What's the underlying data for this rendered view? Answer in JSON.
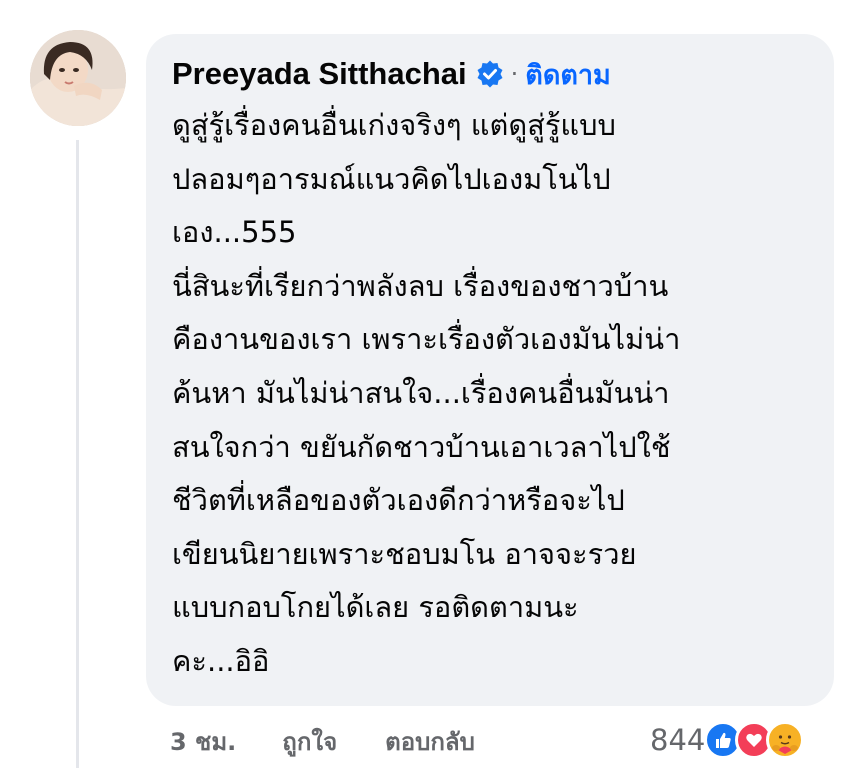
{
  "comment": {
    "author": "Preeyada Sitthachai",
    "verified": true,
    "follow_label": "ติดตาม",
    "separator": "·",
    "lines": [
      "ดูสู่รู้เรื่องคนอื่นเก่งจริงๆ แต่ดูสู่รู้แบบ",
      "ปลอมๆอารมณ์แนวคิดไปเองมโนไป",
      "เอง...555",
      "นี่สินะที่เรียกว่าพลังลบ เรื่องของชาวบ้าน",
      "คืองานของเรา เพราะเรื่องตัวเองมันไม่น่า",
      "ค้นหา มันไม่น่าสนใจ...เรื่องคนอื่นมันน่า",
      "สนใจกว่า ขยันกัดชาวบ้านเอาเวลาไปใช้",
      "ชีวิตที่เหลือของตัวเองดีกว่าหรือจะไป",
      "เขียนนิยายเพราะชอบมโน อาจจะรวย",
      "แบบกอบโกยได้เลย รอติดตามนะ",
      "คะ...อิอิ"
    ]
  },
  "actions": {
    "time": "3 ชม.",
    "like_label": "ถูกใจ",
    "reply_label": "ตอบกลับ"
  },
  "reactions": {
    "count": "844",
    "types": [
      "like-icon",
      "love-icon",
      "care-icon"
    ]
  },
  "colors": {
    "bubble": "#f0f2f5",
    "link": "#0866ff",
    "meta": "#65676b",
    "text": "#050505",
    "like": "#1877f2",
    "love": "#f33e58",
    "care": "#f7b125"
  }
}
